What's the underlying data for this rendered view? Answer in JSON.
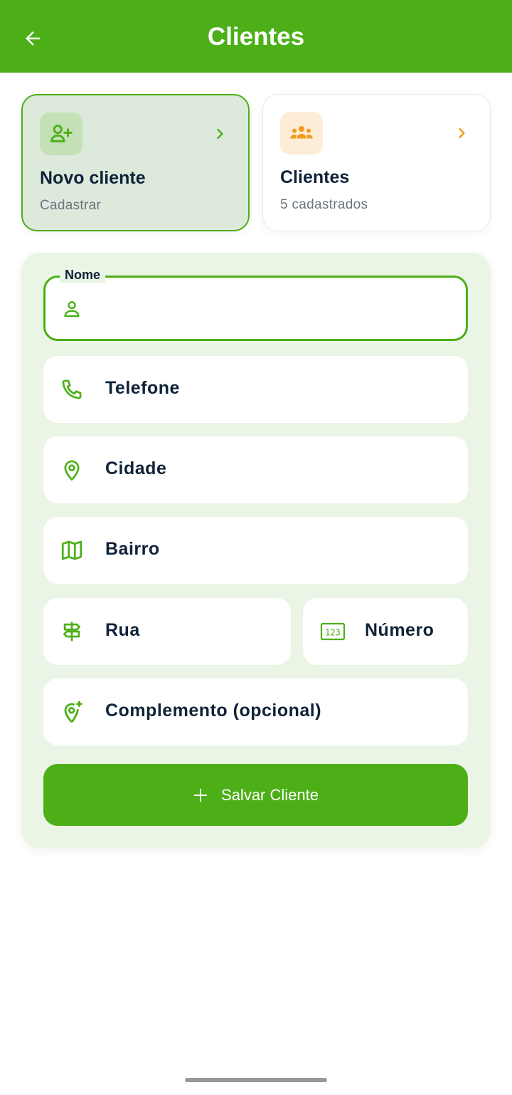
{
  "appbar": {
    "title": "Clientes",
    "color": "#4caf18"
  },
  "cards": [
    {
      "title": "Novo cliente",
      "subtitle": "Cadastrar",
      "icon": "person-add-icon",
      "accent": "#4caf18",
      "selected": true
    },
    {
      "title": "Clientes",
      "subtitle": "5 cadastrados",
      "icon": "group-icon",
      "accent": "#f29a1b",
      "selected": false
    }
  ],
  "form": {
    "nome": {
      "label": "Nome",
      "value": "",
      "icon": "person-icon"
    },
    "telefone": {
      "label": "Telefone",
      "icon": "phone-icon"
    },
    "cidade": {
      "label": "Cidade",
      "icon": "location-pin-icon"
    },
    "bairro": {
      "label": "Bairro",
      "icon": "map-icon"
    },
    "rua": {
      "label": "Rua",
      "icon": "signpost-icon"
    },
    "numero": {
      "label": "Número",
      "icon": "numbers-123-icon"
    },
    "complemento": {
      "label": "Complemento (opcional)",
      "icon": "add-location-icon"
    },
    "save_label": "Salvar Cliente"
  }
}
